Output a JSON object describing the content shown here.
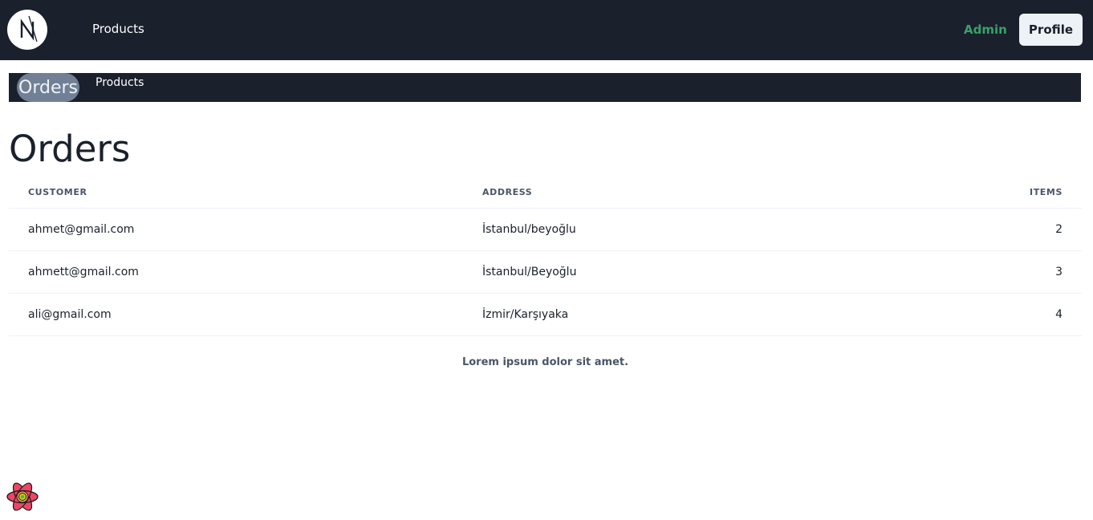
{
  "header": {
    "logo_icon": "nextjs-logo-icon",
    "products_link": "Products",
    "admin_link": "Admin",
    "profile_button": "Profile"
  },
  "subnav": {
    "orders_tab": "Orders",
    "products_tab": "Products"
  },
  "main": {
    "title": "Orders",
    "table": {
      "columns": [
        "CUSTOMER",
        "ADDRESS",
        "ITEMS"
      ],
      "rows": [
        {
          "customer": "ahmet@gmail.com",
          "address": "İstanbul/beyoğlu",
          "items": "2"
        },
        {
          "customer": "ahmett@gmail.com",
          "address": "İstanbul/Beyoğlu",
          "items": "3"
        },
        {
          "customer": "ali@gmail.com",
          "address": "İzmir/Karşıyaka",
          "items": "4"
        }
      ]
    },
    "caption": "Lorem ipsum dolor sit amet."
  },
  "devtools": {
    "icon": "react-query-devtools-icon"
  },
  "colors": {
    "nav_bg": "#1a202c",
    "admin_green": "#38a169",
    "profile_bg": "#edf2f7",
    "active_tab_bg": "#718096"
  }
}
